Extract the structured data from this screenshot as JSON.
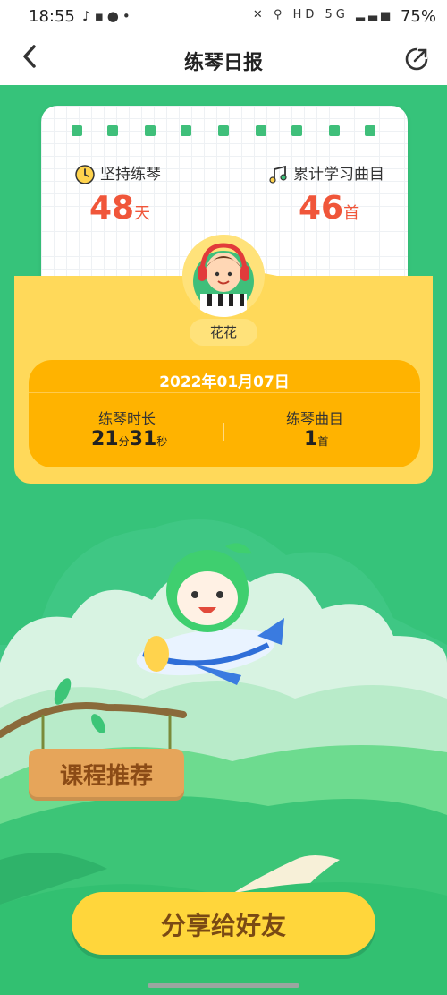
{
  "status_bar": {
    "time": "18:55",
    "left_icons": [
      "silent-mode-icon",
      "message-icon",
      "account-icon",
      "dot-icon"
    ],
    "right_icons": [
      "mute-icon",
      "location-icon",
      "hd-icon",
      "5g-icon",
      "signal-icon"
    ],
    "hd": "HD",
    "network": "5G",
    "battery": "75%"
  },
  "header": {
    "title": "练琴日报",
    "back_icon": "chevron-left-icon",
    "share_icon": "share-icon"
  },
  "stats": {
    "persist_label": "坚持练琴",
    "persist_value": "48",
    "persist_unit": "天",
    "songs_label": "累计学习曲目",
    "songs_value": "46",
    "songs_unit": "首"
  },
  "profile": {
    "name": "花花"
  },
  "daily": {
    "date": "2022年01月07日",
    "duration_label": "练琴时长",
    "minutes": "21",
    "minutes_unit": "分",
    "seconds": "31",
    "seconds_unit": "秒",
    "songs_label": "练琴曲目",
    "songs_value": "1",
    "songs_unit": "首"
  },
  "recommend": {
    "label": "课程推荐"
  },
  "share_button": {
    "label": "分享给好友"
  },
  "colors": {
    "green": "#36c37a",
    "accent_red": "#f0563a",
    "orange": "#ffb300",
    "yellow": "#ffd95a",
    "button_yellow": "#ffd63b"
  }
}
